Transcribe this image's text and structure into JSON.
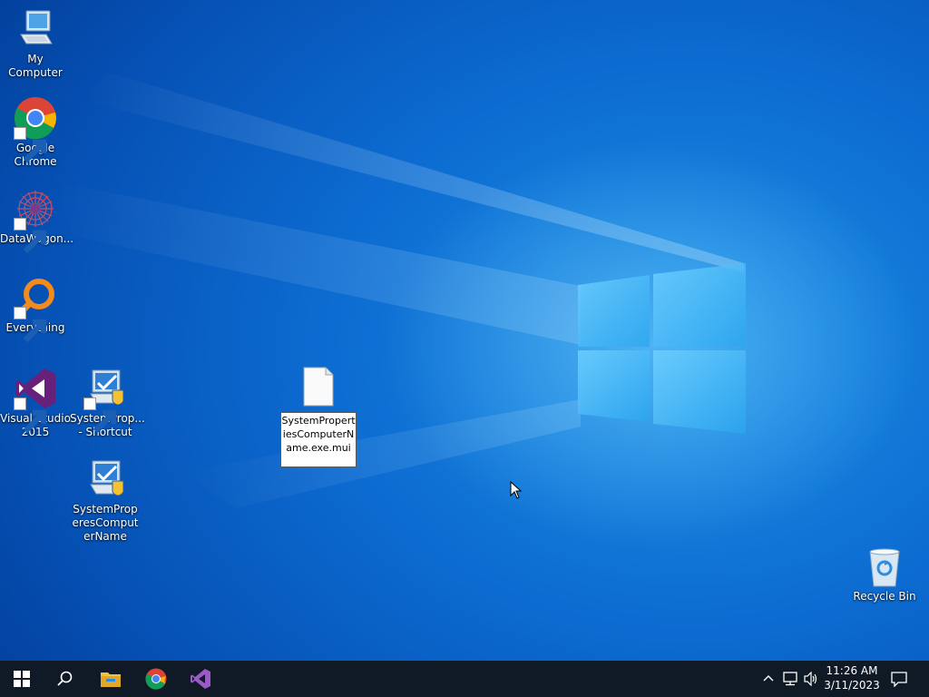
{
  "desktop": {
    "icons": {
      "my_computer": "My Computer",
      "chrome": "Google Chrome",
      "datawagon": "DataWagon...",
      "everything": "Everything",
      "vs2015": "Visual Studio 2015",
      "sysprop_shortcut": "SystemProp... - Shortcut",
      "sysprop_name": "SystemProperesComputerName",
      "recycle_bin": "Recycle Bin"
    },
    "rename_file": {
      "value": "SystemPropertiesComputerName.exe.mui"
    }
  },
  "taskbar": {
    "pinned": [
      "start-icon",
      "search-icon",
      "file-explorer-icon",
      "chrome-icon",
      "visual-studio-icon"
    ],
    "clock": {
      "time": "11:26 AM",
      "date": "3/11/2023"
    },
    "accent": "#101a26"
  }
}
